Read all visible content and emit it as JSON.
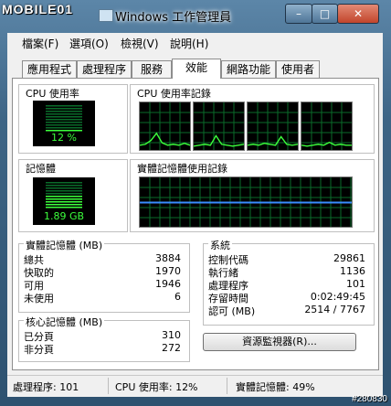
{
  "watermark": "MOBILE01",
  "window": {
    "title": "Windows 工作管理員"
  },
  "menu": [
    "檔案(F)",
    "選項(O)",
    "檢視(V)",
    "說明(H)"
  ],
  "tabs": [
    "應用程式",
    "處理程序",
    "服務",
    "效能",
    "網路功能",
    "使用者"
  ],
  "active_tab": 3,
  "cpu": {
    "label": "CPU 使用率",
    "value": "12 %",
    "percent": 12
  },
  "cpu_history": {
    "label": "CPU 使用率記錄"
  },
  "memory": {
    "label": "記憶體",
    "value": "1.89 GB",
    "fraction": 0.49
  },
  "memory_history": {
    "label": "實體記憶體使用記錄"
  },
  "physical_memory": {
    "title": "實體記憶體 (MB)",
    "rows": [
      {
        "label": "總共",
        "value": "3884"
      },
      {
        "label": "快取的",
        "value": "1970"
      },
      {
        "label": "可用",
        "value": "1946"
      },
      {
        "label": "未使用",
        "value": "6"
      }
    ]
  },
  "kernel_memory": {
    "title": "核心記憶體 (MB)",
    "rows": [
      {
        "label": "已分頁",
        "value": "310"
      },
      {
        "label": "非分頁",
        "value": "272"
      }
    ]
  },
  "system": {
    "title": "系統",
    "rows": [
      {
        "label": "控制代碼",
        "value": "29861"
      },
      {
        "label": "執行緒",
        "value": "1136"
      },
      {
        "label": "處理程序",
        "value": "101"
      },
      {
        "label": "存留時間",
        "value": "0:02:49:45"
      },
      {
        "label": "認可 (MB)",
        "value": "2514 / 7767"
      }
    ]
  },
  "resource_monitor_button": "資源監視器(R)...",
  "status": {
    "processes": "處理程序: 101",
    "cpu": "CPU 使用率: 12%",
    "memory": "實體記憶體: 49%"
  },
  "corner_id": "#280830",
  "colors": {
    "graph_green": "#3cff3c",
    "grid_green": "#0a6b2a",
    "memory_line": "#3a8cff"
  }
}
